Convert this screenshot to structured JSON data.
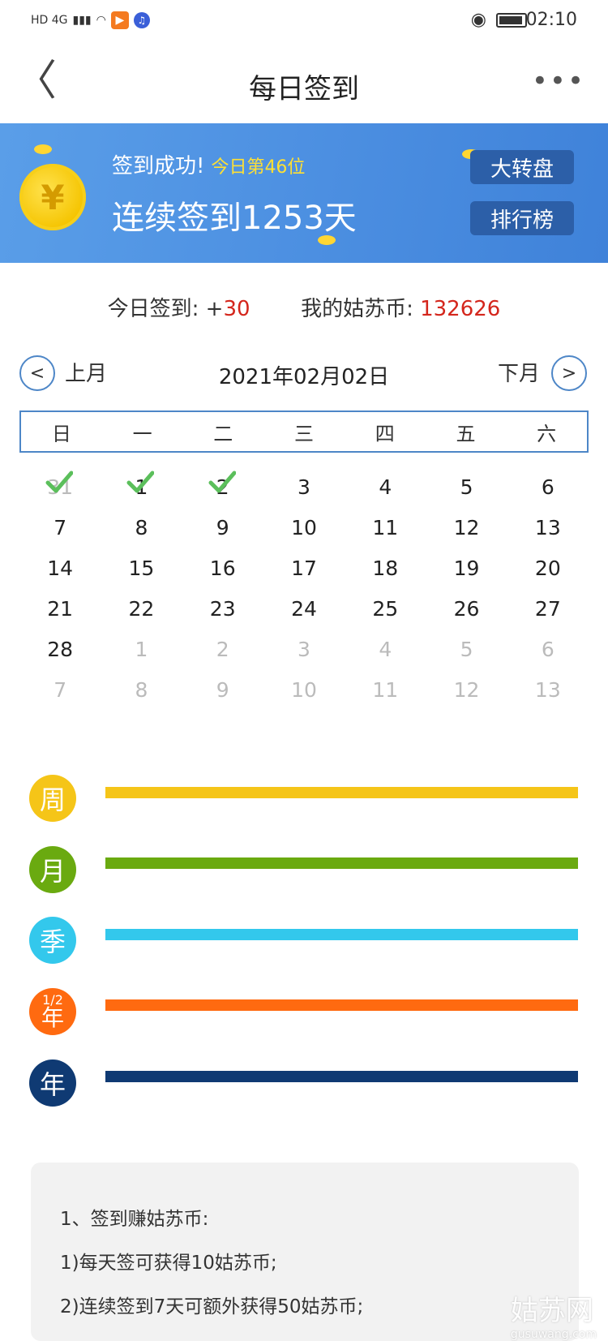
{
  "status": {
    "time": "02:10",
    "network": "HD 4G",
    "app_icon_glyph": "▶",
    "music_icon_glyph": "♫"
  },
  "nav": {
    "back_glyph": "〈",
    "title": "每日签到",
    "more_glyph": "•••"
  },
  "banner": {
    "success": "签到成功!",
    "rank": "今日第46位",
    "streak": "连续签到1253天",
    "wheel_button": "大转盘",
    "rank_button": "排行榜",
    "coin_glyph": "¥"
  },
  "summary": {
    "today_label": "今日签到: +",
    "today_value": "30",
    "coins_label": "我的姑苏币: ",
    "coins_value": "132626"
  },
  "month_nav": {
    "prev_glyph": "<",
    "prev_label": "上月",
    "date": "2021年02月02日",
    "next_label": "下月",
    "next_glyph": ">"
  },
  "calendar": {
    "weekdays": [
      "日",
      "一",
      "二",
      "三",
      "四",
      "五",
      "六"
    ],
    "rows": [
      [
        "31",
        "1",
        "2",
        "3",
        "4",
        "5",
        "6"
      ],
      [
        "7",
        "8",
        "9",
        "10",
        "11",
        "12",
        "13"
      ],
      [
        "14",
        "15",
        "16",
        "17",
        "18",
        "19",
        "20"
      ],
      [
        "21",
        "22",
        "23",
        "24",
        "25",
        "26",
        "27"
      ],
      [
        "28",
        "1",
        "2",
        "3",
        "4",
        "5",
        "6"
      ],
      [
        "7",
        "8",
        "9",
        "10",
        "11",
        "12",
        "13"
      ]
    ],
    "checked": [
      "31",
      "1",
      "2"
    ]
  },
  "rewards": [
    {
      "label": "周",
      "color": "#f5c518"
    },
    {
      "label": "月",
      "color": "#6aaa10"
    },
    {
      "label": "季",
      "color": "#33c8ec"
    },
    {
      "label_top": "1/2",
      "label": "年",
      "color": "#ff6a10"
    },
    {
      "label": "年",
      "color": "#0f3a73"
    }
  ],
  "rules": {
    "line1": "1、签到赚姑苏币:",
    "line2": "1)每天签可获得10姑苏币;",
    "line3": "2)连续签到7天可额外获得50姑苏币;"
  },
  "watermark": {
    "main": "姑苏网",
    "sub": "gusuwang.com"
  }
}
